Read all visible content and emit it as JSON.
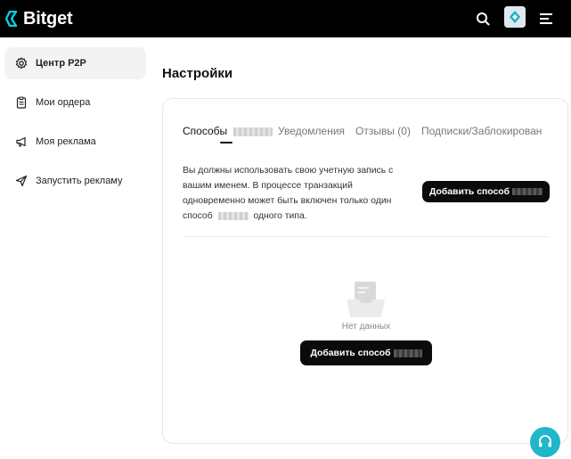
{
  "header": {
    "brand": "Bitget",
    "icons": {
      "search": "search-icon",
      "menu": "hamburger-menu-icon",
      "avatar": "avatar"
    },
    "colors": {
      "background": "#000000",
      "brand": "#00d4e6"
    }
  },
  "sidebar": {
    "items": [
      {
        "label": "Центр P2P",
        "icon": "gear-icon",
        "active": true
      },
      {
        "label": "Мои ордера",
        "icon": "clipboard-icon",
        "active": false
      },
      {
        "label": "Моя реклама",
        "icon": "megaphone-icon",
        "active": false
      },
      {
        "label": "Запустить рекламу",
        "icon": "send-icon",
        "active": false
      }
    ]
  },
  "main": {
    "title": "Настройки",
    "tabs": [
      {
        "label": "Способы",
        "active": true
      },
      {
        "label": "Уведомления",
        "active": false
      },
      {
        "label": "Отзывы (0)",
        "active": false
      },
      {
        "label": "Подписки/Заблокирован",
        "active": false
      }
    ],
    "info_text": "Вы должны использовать свою учетную запись с вашим именем. В процессе транзакций одновременно может быть включен только один способ",
    "info_text_tail": "одного типа.",
    "add_button_label": "Добавить способ",
    "empty_text": "Нет данных",
    "empty_add_button_label": "Добавить способ"
  },
  "support": {
    "icon": "headset-icon",
    "color": "#1fb7c9"
  }
}
